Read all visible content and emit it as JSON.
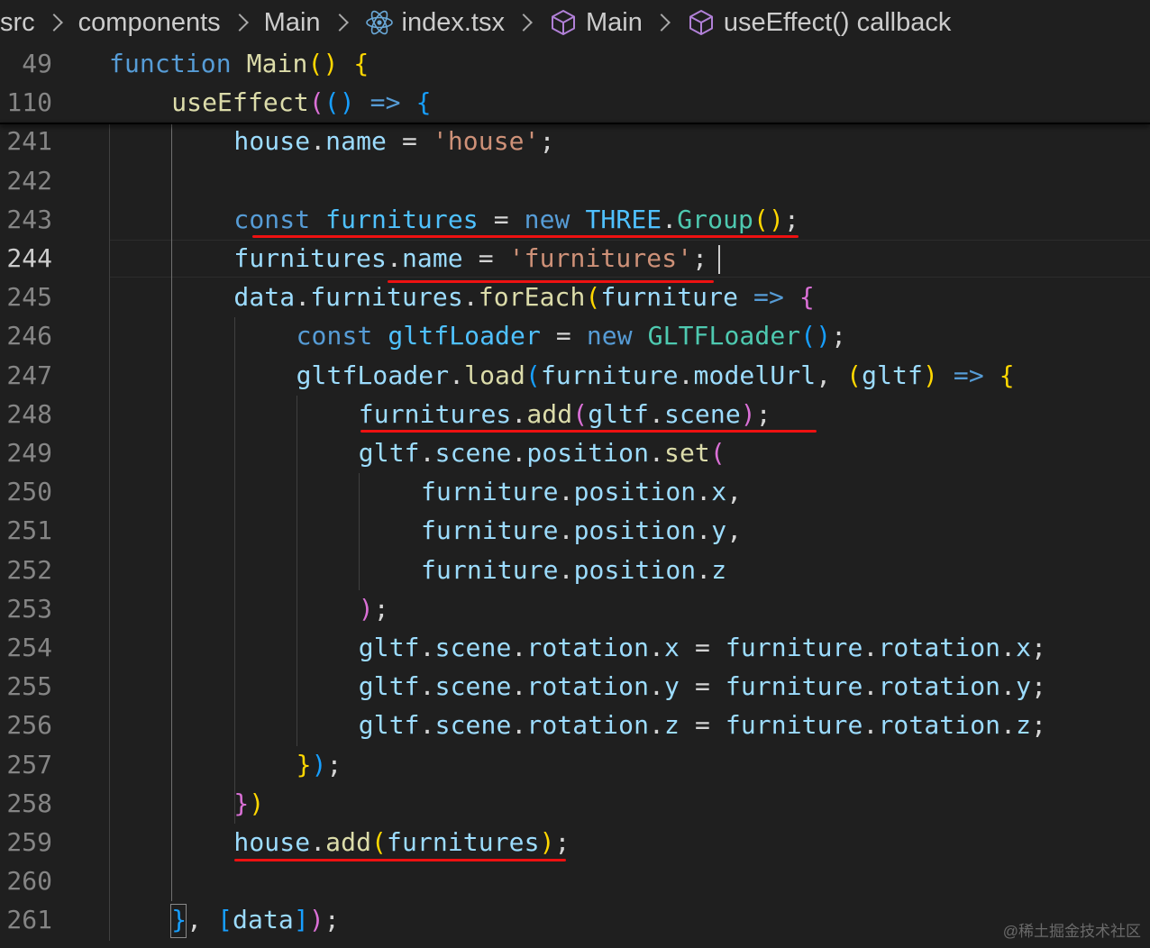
{
  "breadcrumb": {
    "items": [
      {
        "label": "src",
        "icon": ""
      },
      {
        "label": "components",
        "icon": ""
      },
      {
        "label": "Main",
        "icon": ""
      },
      {
        "label": "index.tsx",
        "icon": "react-icon"
      },
      {
        "label": "Main",
        "icon": "cube-icon"
      },
      {
        "label": "useEffect() callback",
        "icon": "cube-icon"
      }
    ]
  },
  "editor": {
    "current_line": "244",
    "lines": [
      {
        "num": "49",
        "tokens": [
          [
            "k",
            "function"
          ],
          [
            "p",
            " "
          ],
          [
            "f",
            "Main"
          ],
          [
            "b1",
            "()"
          ],
          [
            "p",
            " "
          ],
          [
            "b1",
            "{"
          ]
        ]
      },
      {
        "num": "110",
        "tokens": [
          [
            "f",
            "useEffect"
          ],
          [
            "b2",
            "("
          ],
          [
            "b3",
            "()"
          ],
          [
            "p",
            " "
          ],
          [
            "k",
            "=>"
          ],
          [
            "p",
            " "
          ],
          [
            "b3",
            "{"
          ]
        ]
      },
      {
        "num": "241",
        "tokens": [
          [
            "v",
            "house"
          ],
          [
            "p",
            "."
          ],
          [
            "v",
            "name"
          ],
          [
            "p",
            " = "
          ],
          [
            "s",
            "'house'"
          ],
          [
            "p",
            ";"
          ]
        ]
      },
      {
        "num": "242",
        "tokens": []
      },
      {
        "num": "243",
        "tokens": [
          [
            "k",
            "const"
          ],
          [
            "p",
            " "
          ],
          [
            "c",
            "furnitures"
          ],
          [
            "p",
            " = "
          ],
          [
            "k",
            "new"
          ],
          [
            "p",
            " "
          ],
          [
            "c",
            "THREE"
          ],
          [
            "p",
            "."
          ],
          [
            "t",
            "Group"
          ],
          [
            "b1",
            "()"
          ],
          [
            "p",
            ";"
          ]
        ]
      },
      {
        "num": "244",
        "tokens": [
          [
            "v",
            "furnitures"
          ],
          [
            "p",
            "."
          ],
          [
            "v",
            "name"
          ],
          [
            "p",
            " = "
          ],
          [
            "s",
            "'furnitures'"
          ],
          [
            "p",
            ";"
          ]
        ]
      },
      {
        "num": "245",
        "tokens": [
          [
            "v",
            "data"
          ],
          [
            "p",
            "."
          ],
          [
            "v",
            "furnitures"
          ],
          [
            "p",
            "."
          ],
          [
            "f",
            "forEach"
          ],
          [
            "b1",
            "("
          ],
          [
            "v",
            "furniture"
          ],
          [
            "p",
            " "
          ],
          [
            "k",
            "=>"
          ],
          [
            "p",
            " "
          ],
          [
            "b2",
            "{"
          ]
        ]
      },
      {
        "num": "246",
        "tokens": [
          [
            "k",
            "const"
          ],
          [
            "p",
            " "
          ],
          [
            "c",
            "gltfLoader"
          ],
          [
            "p",
            " = "
          ],
          [
            "k",
            "new"
          ],
          [
            "p",
            " "
          ],
          [
            "t",
            "GLTFLoader"
          ],
          [
            "b3",
            "()"
          ],
          [
            "p",
            ";"
          ]
        ]
      },
      {
        "num": "247",
        "tokens": [
          [
            "v",
            "gltfLoader"
          ],
          [
            "p",
            "."
          ],
          [
            "f",
            "load"
          ],
          [
            "b3",
            "("
          ],
          [
            "v",
            "furniture"
          ],
          [
            "p",
            "."
          ],
          [
            "v",
            "modelUrl"
          ],
          [
            "p",
            ", "
          ],
          [
            "b1",
            "("
          ],
          [
            "v",
            "gltf"
          ],
          [
            "b1",
            ")"
          ],
          [
            "p",
            " "
          ],
          [
            "k",
            "=>"
          ],
          [
            "p",
            " "
          ],
          [
            "b1",
            "{"
          ]
        ]
      },
      {
        "num": "248",
        "tokens": [
          [
            "v",
            "furnitures"
          ],
          [
            "p",
            "."
          ],
          [
            "f",
            "add"
          ],
          [
            "b2",
            "("
          ],
          [
            "v",
            "gltf"
          ],
          [
            "p",
            "."
          ],
          [
            "v",
            "scene"
          ],
          [
            "b2",
            ")"
          ],
          [
            "p",
            ";"
          ]
        ]
      },
      {
        "num": "249",
        "tokens": [
          [
            "v",
            "gltf"
          ],
          [
            "p",
            "."
          ],
          [
            "v",
            "scene"
          ],
          [
            "p",
            "."
          ],
          [
            "v",
            "position"
          ],
          [
            "p",
            "."
          ],
          [
            "f",
            "set"
          ],
          [
            "b2",
            "("
          ]
        ]
      },
      {
        "num": "250",
        "tokens": [
          [
            "v",
            "furniture"
          ],
          [
            "p",
            "."
          ],
          [
            "v",
            "position"
          ],
          [
            "p",
            "."
          ],
          [
            "v",
            "x"
          ],
          [
            "p",
            ","
          ]
        ]
      },
      {
        "num": "251",
        "tokens": [
          [
            "v",
            "furniture"
          ],
          [
            "p",
            "."
          ],
          [
            "v",
            "position"
          ],
          [
            "p",
            "."
          ],
          [
            "v",
            "y"
          ],
          [
            "p",
            ","
          ]
        ]
      },
      {
        "num": "252",
        "tokens": [
          [
            "v",
            "furniture"
          ],
          [
            "p",
            "."
          ],
          [
            "v",
            "position"
          ],
          [
            "p",
            "."
          ],
          [
            "v",
            "z"
          ]
        ]
      },
      {
        "num": "253",
        "tokens": [
          [
            "b2",
            ")"
          ],
          [
            "p",
            ";"
          ]
        ]
      },
      {
        "num": "254",
        "tokens": [
          [
            "v",
            "gltf"
          ],
          [
            "p",
            "."
          ],
          [
            "v",
            "scene"
          ],
          [
            "p",
            "."
          ],
          [
            "v",
            "rotation"
          ],
          [
            "p",
            "."
          ],
          [
            "v",
            "x"
          ],
          [
            "p",
            " = "
          ],
          [
            "v",
            "furniture"
          ],
          [
            "p",
            "."
          ],
          [
            "v",
            "rotation"
          ],
          [
            "p",
            "."
          ],
          [
            "v",
            "x"
          ],
          [
            "p",
            ";"
          ]
        ]
      },
      {
        "num": "255",
        "tokens": [
          [
            "v",
            "gltf"
          ],
          [
            "p",
            "."
          ],
          [
            "v",
            "scene"
          ],
          [
            "p",
            "."
          ],
          [
            "v",
            "rotation"
          ],
          [
            "p",
            "."
          ],
          [
            "v",
            "y"
          ],
          [
            "p",
            " = "
          ],
          [
            "v",
            "furniture"
          ],
          [
            "p",
            "."
          ],
          [
            "v",
            "rotation"
          ],
          [
            "p",
            "."
          ],
          [
            "v",
            "y"
          ],
          [
            "p",
            ";"
          ]
        ]
      },
      {
        "num": "256",
        "tokens": [
          [
            "v",
            "gltf"
          ],
          [
            "p",
            "."
          ],
          [
            "v",
            "scene"
          ],
          [
            "p",
            "."
          ],
          [
            "v",
            "rotation"
          ],
          [
            "p",
            "."
          ],
          [
            "v",
            "z"
          ],
          [
            "p",
            " = "
          ],
          [
            "v",
            "furniture"
          ],
          [
            "p",
            "."
          ],
          [
            "v",
            "rotation"
          ],
          [
            "p",
            "."
          ],
          [
            "v",
            "z"
          ],
          [
            "p",
            ";"
          ]
        ]
      },
      {
        "num": "257",
        "tokens": [
          [
            "b1",
            "}"
          ],
          [
            "b3",
            ")"
          ],
          [
            "p",
            ";"
          ]
        ]
      },
      {
        "num": "258",
        "tokens": [
          [
            "b2",
            "}"
          ],
          [
            "b1",
            ")"
          ]
        ]
      },
      {
        "num": "259",
        "tokens": [
          [
            "v",
            "house"
          ],
          [
            "p",
            "."
          ],
          [
            "f",
            "add"
          ],
          [
            "b1",
            "("
          ],
          [
            "v",
            "furnitures"
          ],
          [
            "b1",
            ")"
          ],
          [
            "p",
            ";"
          ]
        ]
      },
      {
        "num": "260",
        "tokens": []
      },
      {
        "num": "261",
        "tokens": [
          [
            "b3",
            "}"
          ],
          [
            "p",
            ", "
          ],
          [
            "b3",
            "["
          ],
          [
            "v",
            "data"
          ],
          [
            "b3",
            "]"
          ],
          [
            "b2",
            ")"
          ],
          [
            "p",
            ";"
          ]
        ]
      }
    ]
  },
  "colors": {
    "underline": "#ee1111",
    "background": "#1f1f1f"
  },
  "watermark": "@稀土掘金技术社区"
}
